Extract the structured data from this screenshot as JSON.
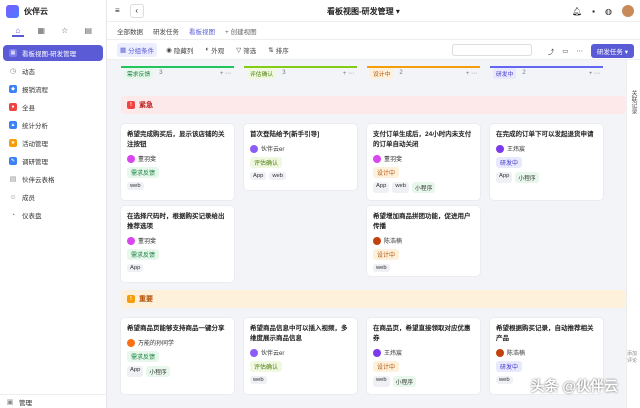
{
  "app": {
    "name": "伙伴云"
  },
  "sidebar": {
    "items": [
      {
        "label": "看板视图-研发管理",
        "icon": "kanban-icon",
        "color": "#5b5bd6"
      },
      {
        "label": "动态",
        "icon": "activity-icon",
        "color": ""
      },
      {
        "label": "报销流程",
        "icon": "flow-icon",
        "color": "#3b82f6"
      },
      {
        "label": "全县",
        "icon": "county-icon",
        "color": "#ef4444"
      },
      {
        "label": "统计分析",
        "icon": "stats-icon",
        "color": "#3b82f6"
      },
      {
        "label": "活动管理",
        "icon": "event-icon",
        "color": "#f59e0b"
      },
      {
        "label": "调研管理",
        "icon": "survey-icon",
        "color": "#3b82f6"
      },
      {
        "label": "伙伴云表格",
        "icon": "table-icon",
        "color": ""
      },
      {
        "label": "成员",
        "icon": "member-icon",
        "color": ""
      },
      {
        "label": "仪表盘",
        "icon": "dashboard-icon",
        "color": ""
      }
    ],
    "bottom_label": "管理"
  },
  "header": {
    "title": "看板视图-研发管理"
  },
  "tabs": [
    {
      "label": "全部数据"
    },
    {
      "label": "研发任务"
    },
    {
      "label": "看板视图"
    }
  ],
  "tab_add": "创建视图",
  "toolbar": {
    "group": "分组条件",
    "hide": "隐藏列",
    "appearance": "外观",
    "filter": "筛选",
    "sort": "排序",
    "primary": "研发任务"
  },
  "right_panel": {
    "label": "关联记录",
    "ai": "添加评论"
  },
  "columns": [
    {
      "name": "需求反馈",
      "count": "3",
      "color": "#22c55e",
      "bg": "#e7f7ec"
    },
    {
      "name": "评估确认",
      "count": "3",
      "color": "#84cc16",
      "bg": "#f0f8e0"
    },
    {
      "name": "设计中",
      "count": "2",
      "color": "#f59e0b",
      "bg": "#fdf1dc"
    },
    {
      "name": "研发中",
      "count": "2",
      "color": "#6366f1",
      "bg": "#e8e9fd"
    }
  ],
  "groups": [
    {
      "label": "紧急",
      "color": "#ef4444",
      "bg": "#fde8ea"
    },
    {
      "label": "重要",
      "color": "#f59e0b",
      "bg": "#fdf1dc"
    }
  ],
  "cards": [
    {
      "title": "希望完成购买后，显示该店铺的关注按钮",
      "owner": "董羽斐",
      "status": "需求反馈",
      "chips": [
        "web"
      ]
    },
    {
      "title": "在选择尺码时，根据购买记录给出推荐选项",
      "owner": "董羽斐",
      "status": "需求反馈",
      "chips": [
        "App"
      ]
    },
    {
      "title": "首次登陆给予[新手引导]",
      "owner": "伙伴云er",
      "status": "评估确认",
      "chips": [
        "App",
        "web"
      ]
    },
    {
      "title": "支付订单生成后，24小时内未支付的订单自动关闭",
      "owner": "董羽斐",
      "status": "设计中",
      "chips": [
        "App",
        "web",
        "小程序"
      ]
    },
    {
      "title": "希望增加商品拼团功能，促进用户传播",
      "owner": "陈浩楠",
      "status": "设计中",
      "chips": [
        "web"
      ]
    },
    {
      "title": "在完成的订单下可以发起退货申请",
      "owner": "王炜宸",
      "status": "研发中",
      "chips": [
        "App",
        "小程序"
      ]
    },
    {
      "title": "希望商品页能够支持商品一键分享",
      "owner": "万能的孙同学",
      "status": "需求反馈",
      "chips": [
        "App",
        "小程序"
      ]
    },
    {
      "title": "希望商品信息中可以插入视频，多维度展示商品信息",
      "owner": "伙伴云er",
      "status": "评估确认",
      "chips": [
        "web"
      ]
    },
    {
      "title": "在商品页，希望直接领取对应优惠券",
      "owner": "王炜宸",
      "status": "设计中",
      "chips": [
        "web",
        "小程序"
      ]
    },
    {
      "title": "希望根据购买记录，自动推荐相关产品",
      "owner": "陈浩楠",
      "status": "研发中",
      "chips": [
        "web"
      ]
    }
  ],
  "watermark": "头条 @伙伴云"
}
